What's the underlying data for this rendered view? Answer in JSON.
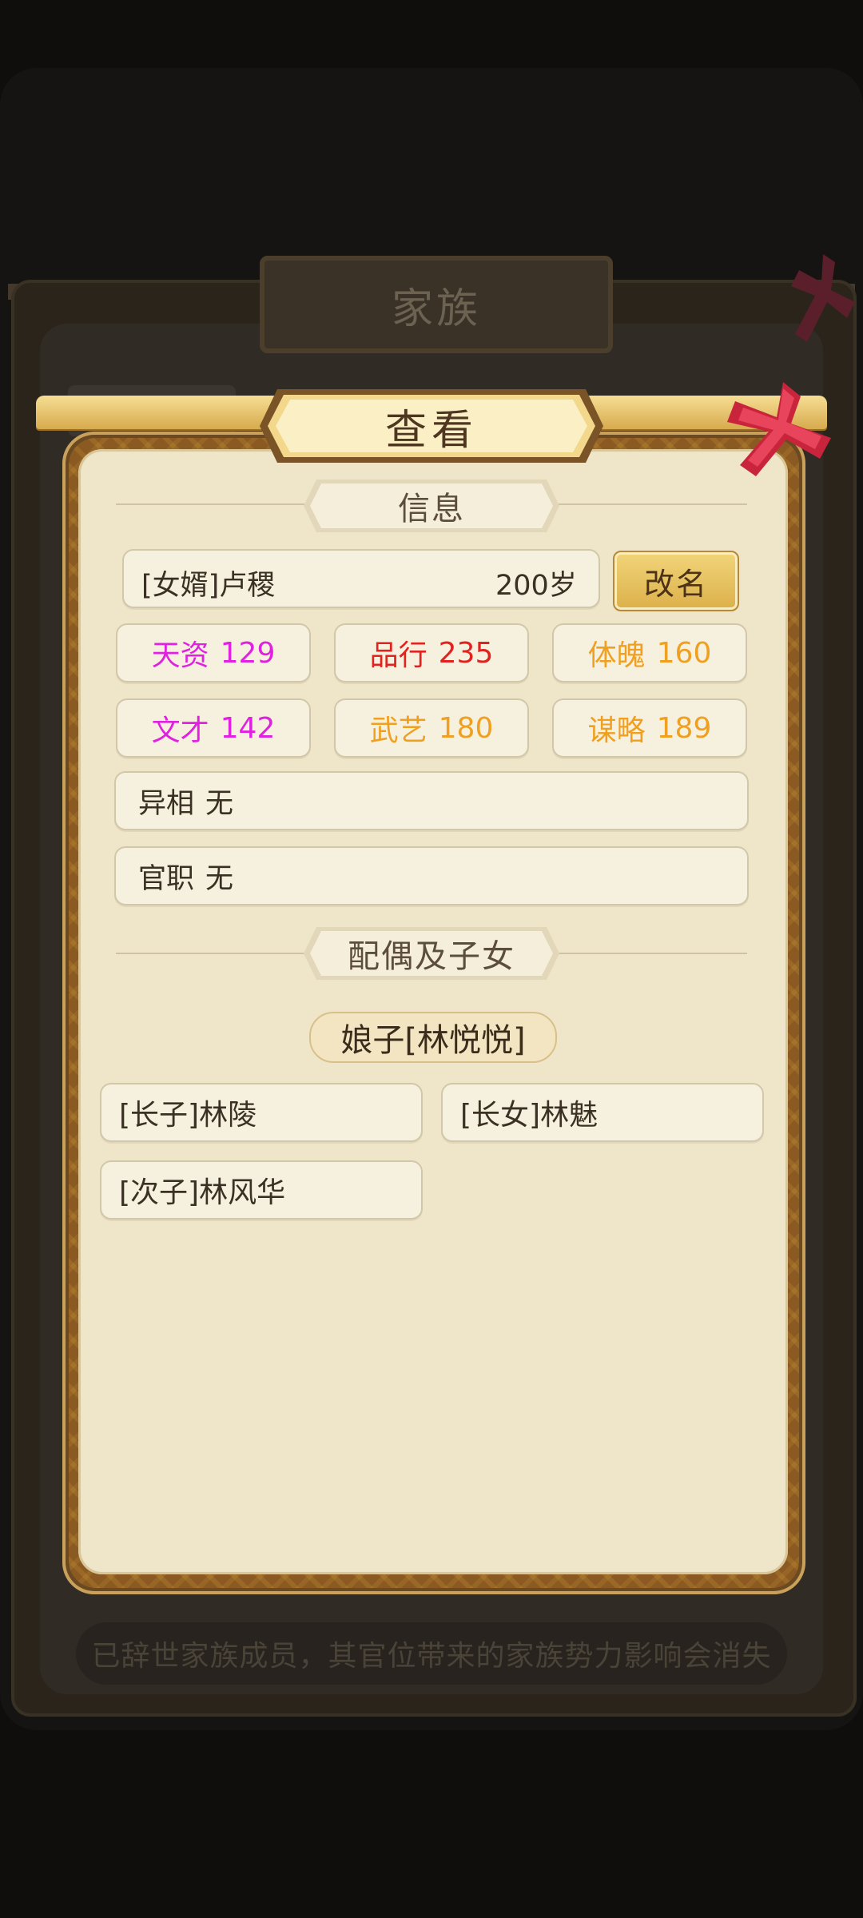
{
  "background": {
    "window_title": "家族",
    "footer_text": "已辞世家族成员，其官位带来的家族势力影响会消失"
  },
  "dialog": {
    "title": "查看",
    "info_section": "信息",
    "member": {
      "name": "[女婿]卢稷",
      "age": "200岁",
      "rename_label": "改名"
    },
    "stats": [
      {
        "label": "天资",
        "value": "129",
        "color": "#e021e0"
      },
      {
        "label": "品行",
        "value": "235",
        "color": "#e0231e"
      },
      {
        "label": "体魄",
        "value": "160",
        "color": "#f0a020"
      },
      {
        "label": "文才",
        "value": "142",
        "color": "#e021e0"
      },
      {
        "label": "武艺",
        "value": "180",
        "color": "#f0a020"
      },
      {
        "label": "谋略",
        "value": "189",
        "color": "#f0a020"
      }
    ],
    "traits": {
      "label": "异相",
      "value": "无"
    },
    "office": {
      "label": "官职",
      "value": "无"
    },
    "family_section": "配偶及子女",
    "spouse": "娘子[林悦悦]",
    "children": [
      "[长子]林陵",
      "[长女]林魅",
      "[次子]林风华"
    ]
  }
}
